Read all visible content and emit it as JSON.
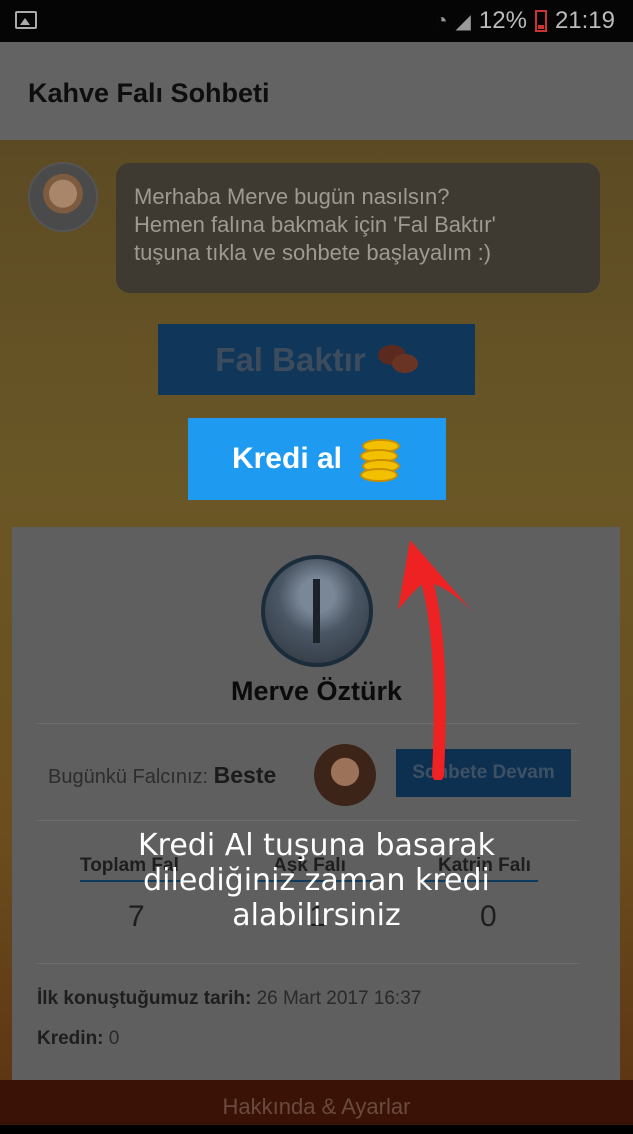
{
  "status_bar": {
    "battery": "12%",
    "time": "21:19"
  },
  "app": {
    "title": "Kahve Falı Sohbeti"
  },
  "chat": {
    "lines": [
      "Merhaba  Merve       bugün nasılsın?",
      "Hemen falına bakmak için 'Fal Baktır'",
      "tuşuna tıkla ve sohbete başlayalım :)"
    ]
  },
  "buttons": {
    "fal_baktir": "Fal Baktır",
    "kredi_al": "Kredi al",
    "sohbete_devam": "Sohbete Devam"
  },
  "profile": {
    "name": "Merve Öztürk",
    "falci_label": "Bugünkü Falcınız:",
    "falci_name": "Beste"
  },
  "stats": {
    "toplam_label": "Toplam Fal",
    "toplam_value": "7",
    "ask_label": "Aşk Falı",
    "ask_value": "1",
    "katrin_label": "Katrin Falı",
    "katrin_value": "0"
  },
  "info": {
    "first_chat_label": "İlk konuştuğumuz tarih:",
    "first_chat_date": "26 Mart 2017 16:37",
    "credit_label": "Kredin:",
    "credit_value": "0"
  },
  "footer": {
    "label": "Hakkında & Ayarlar"
  },
  "tutorial": {
    "lines": [
      "Kredi Al tuşuna basarak",
      "dilediğiniz zaman kredi",
      "alabilirsiniz"
    ]
  },
  "colors": {
    "accent": "#1e9bf0",
    "arrow": "#ee2222",
    "coin": "#f3c000"
  },
  "icons": {
    "gallery": "image-icon",
    "wifi": "wifi-icon",
    "signal": "signal-icon",
    "battery": "battery-icon",
    "chat": "chat-bubbles-icon",
    "coins": "coins-icon"
  }
}
